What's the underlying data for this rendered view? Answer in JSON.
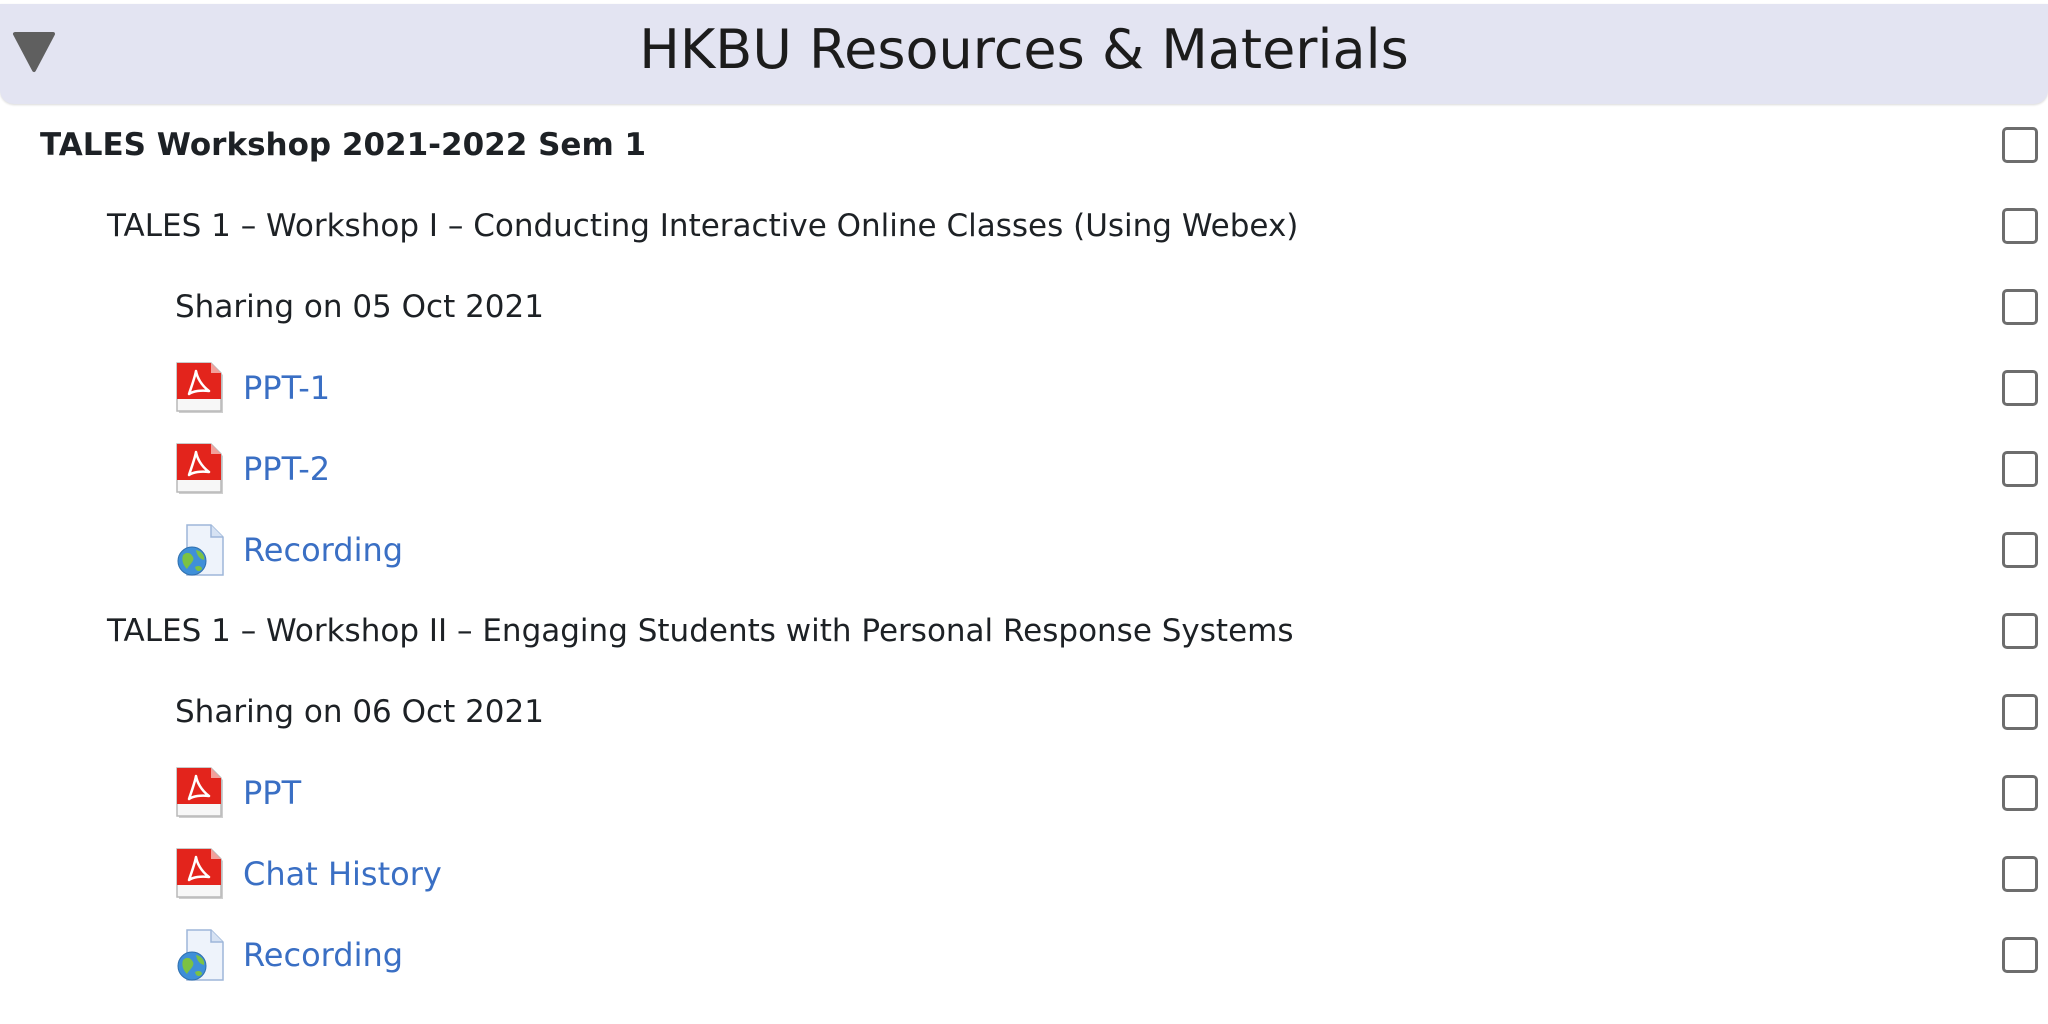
{
  "header": {
    "title": "HKBU Resources & Materials",
    "toggle_icon": "collapse-triangle-icon"
  },
  "colors": {
    "header_bg": "#e3e4f2",
    "link": "#3a6fc4",
    "text": "#1d2125"
  },
  "items": [
    {
      "label": "TALES Workshop 2021-2022 Sem 1",
      "type": "heading"
    },
    {
      "label": "TALES 1 – Workshop I – Conducting Interactive Online Classes (Using Webex)",
      "type": "subheading"
    },
    {
      "label": "Sharing on 05 Oct 2021",
      "type": "label"
    },
    {
      "label": "PPT-1",
      "type": "resource",
      "icon": "pdf-icon"
    },
    {
      "label": "PPT-2",
      "type": "resource",
      "icon": "pdf-icon"
    },
    {
      "label": "Recording",
      "type": "resource",
      "icon": "url-icon"
    },
    {
      "label": "TALES 1 – Workshop II – Engaging Students with Personal Response Systems",
      "type": "subheading"
    },
    {
      "label": "Sharing on 06 Oct 2021",
      "type": "label"
    },
    {
      "label": "PPT",
      "type": "resource",
      "icon": "pdf-icon"
    },
    {
      "label": "Chat History",
      "type": "resource",
      "icon": "pdf-icon"
    },
    {
      "label": "Recording",
      "type": "resource",
      "icon": "url-icon"
    }
  ]
}
